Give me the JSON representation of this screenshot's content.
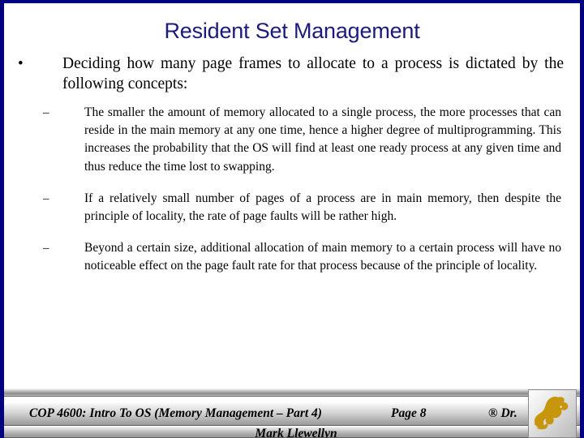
{
  "slide": {
    "title": "Resident Set Management",
    "accent_color": "#1b1b7d",
    "border_color": "#000080",
    "background_color": "#ffffff"
  },
  "content": {
    "bullets": [
      {
        "level": 1,
        "marker": "•",
        "marker_name": "round-bullet",
        "text": "Deciding how many page frames to allocate to a process is dictated by the following concepts:"
      },
      {
        "level": 2,
        "marker": "–",
        "marker_name": "dash-bullet",
        "text": "The smaller the amount of memory allocated to a single process, the more processes that can reside in the main memory at any one time, hence a higher degree of multiprogramming.   This increases the probability that the OS will find at least one ready process at any given time and thus reduce the time lost to swapping."
      },
      {
        "level": 2,
        "marker": "–",
        "marker_name": "dash-bullet",
        "text": "If a relatively small number of pages of a process are in main memory, then despite the principle of locality, the rate of page faults will be rather high."
      },
      {
        "level": 2,
        "marker": "–",
        "marker_name": "dash-bullet",
        "text": "Beyond a certain size, additional allocation of main memory to a certain process will have no noticeable effect on the page fault rate for that process because of the principle of locality."
      }
    ]
  },
  "footer": {
    "course": "COP 4600: Intro To OS  (Memory Management – Part 4)",
    "page": "Page 8",
    "copyright": "® Dr.",
    "author": "Mark Llewellyn",
    "logo_name": "ucf-pegasus-logo",
    "logo_color": "#c8960c"
  }
}
